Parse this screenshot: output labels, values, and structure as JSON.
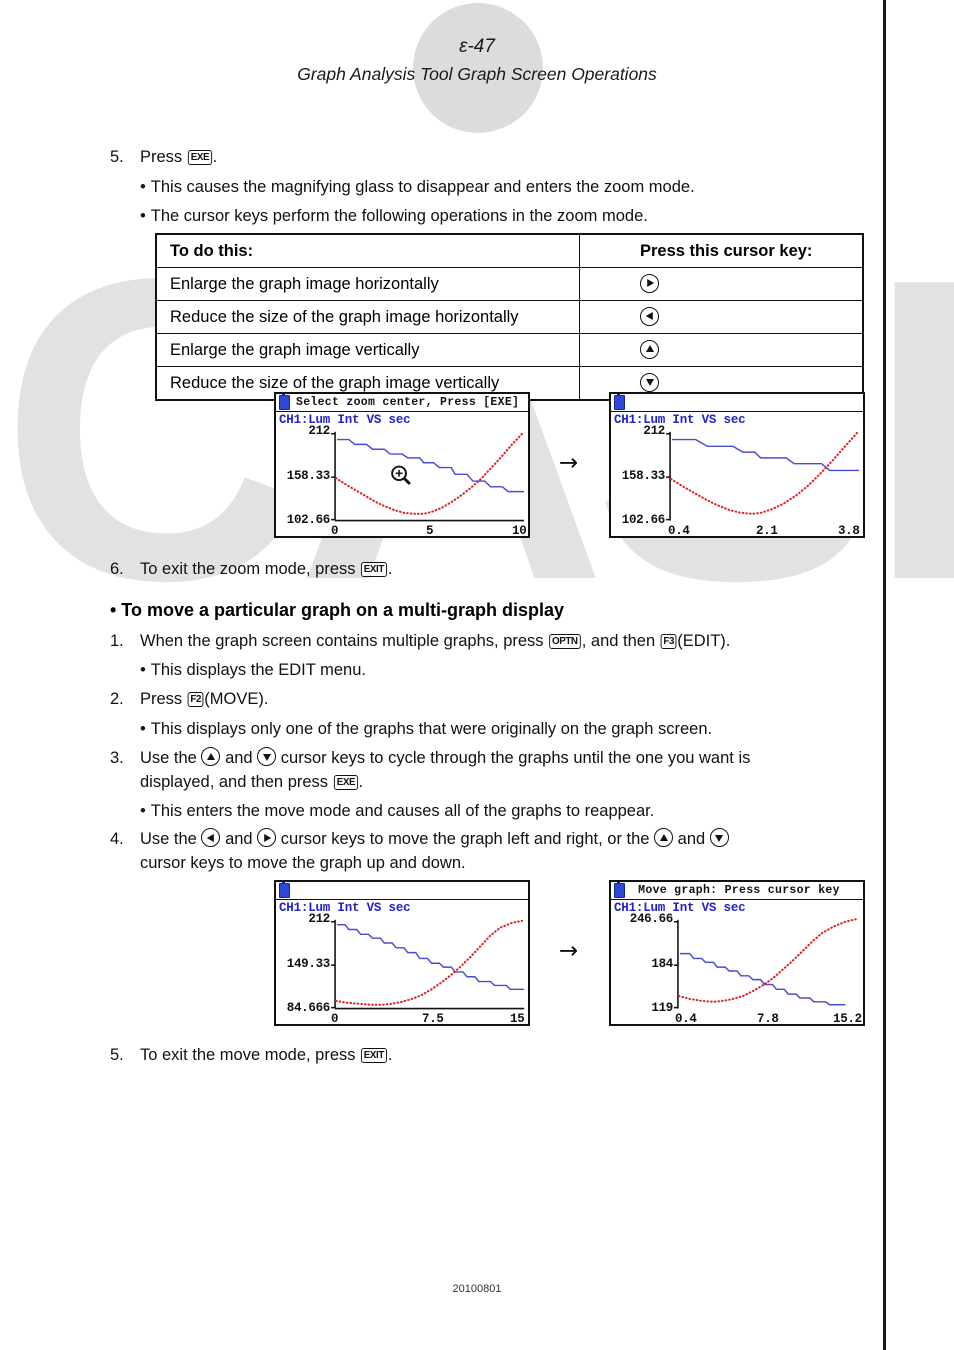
{
  "header": {
    "page_number": "ε-47",
    "title": "Graph Analysis Tool Graph Screen Operations"
  },
  "watermark": {
    "text": "CASIO"
  },
  "footer": {
    "doc_code": "20100801"
  },
  "steps": {
    "s5_num": "5.",
    "s5_text_before": "Press",
    "s5_key": "EXE",
    "s5_text_after": ".",
    "s5_b1": "This causes the magnifying glass to disappear and enters the zoom mode.",
    "s5_b2": "The cursor keys perform the following operations in the zoom mode.",
    "s6_num": "6.",
    "s6_text_before": "To exit the zoom mode, press",
    "s6_key": "EXIT",
    "s6_text_after": ".",
    "heading": "• To move a particular graph on a multi-graph display",
    "m1_num": "1.",
    "m1_a": "When the graph screen contains multiple graphs, press",
    "m1_key1": "OPTN",
    "m1_b": ", and then",
    "m1_key2": "F3",
    "m1_c": "(EDIT).",
    "m1_bullet": "This displays the EDIT menu.",
    "m2_num": "2.",
    "m2_a": "Press",
    "m2_key": "F2",
    "m2_b": "(MOVE).",
    "m2_bullet": "This displays only one of the graphs that were originally on the graph screen.",
    "m3_num": "3.",
    "m3_a": "Use the",
    "m3_b": "and",
    "m3_c": "cursor keys to cycle through the graphs until the one you want is",
    "m3_d": "displayed, and then press",
    "m3_key": "EXE",
    "m3_e": ".",
    "m3_bullet": "This enters the move mode and causes all of the graphs to reappear.",
    "m4_num": "4.",
    "m4_a": "Use the",
    "m4_b": "and",
    "m4_c": "cursor keys to move the graph left and right, or the",
    "m4_d": "and",
    "m4_e": "cursor keys to move the graph up and down.",
    "m5_num": "5.",
    "m5_a": "To exit the move mode, press",
    "m5_key": "EXIT",
    "m5_b": "."
  },
  "table": {
    "col1_header": "To do this:",
    "col2_header": "Press this cursor key:",
    "rows": [
      {
        "action": "Enlarge the graph image horizontally",
        "key": "right"
      },
      {
        "action": "Reduce the size of the graph image horizontally",
        "key": "left"
      },
      {
        "action": "Enlarge the graph image vertically",
        "key": "up"
      },
      {
        "action": "Reduce the size of the graph image vertically",
        "key": "down"
      }
    ]
  },
  "screens": {
    "zoom_before": {
      "title": "Select zoom center, Press [EXE]",
      "channel": "CH1:Lum Int VS sec",
      "y_labels": [
        "212",
        "158.33",
        "102.66"
      ],
      "x_labels": [
        "0",
        "5",
        "10"
      ],
      "has_magnifier": true
    },
    "zoom_after": {
      "title": "",
      "channel": "CH1:Lum Int VS sec",
      "y_labels": [
        "212",
        "158.33",
        "102.66"
      ],
      "x_labels": [
        "0.4",
        "2.1",
        "3.8"
      ],
      "has_magnifier": false
    },
    "move_before": {
      "title": "",
      "channel": "CH1:Lum Int VS sec",
      "y_labels": [
        "212",
        "149.33",
        "84.666"
      ],
      "x_labels": [
        "0",
        "7.5",
        "15"
      ],
      "has_magnifier": false
    },
    "move_after": {
      "title": "Move graph: Press cursor key",
      "channel": "CH1:Lum Int VS sec",
      "y_labels": [
        "246.66",
        "184",
        "119"
      ],
      "x_labels": [
        "0.4",
        "7.8",
        "15.2"
      ],
      "has_magnifier": false
    },
    "arrow_glyph": "→"
  },
  "colors": {
    "trace_blue": "#4a4ad0",
    "trace_red": "#e02020",
    "channel_label": "#2222cc",
    "watermark_gray": "#e2e2e2"
  }
}
